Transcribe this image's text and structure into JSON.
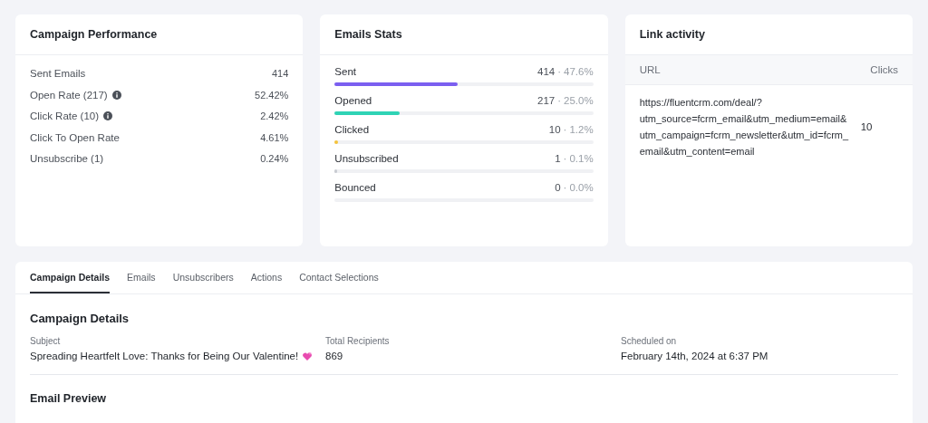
{
  "performance": {
    "title": "Campaign Performance",
    "rows": [
      {
        "label": "Sent Emails",
        "value": "414",
        "info": false
      },
      {
        "label": "Open Rate (217)",
        "value": "52.42%",
        "info": true
      },
      {
        "label": "Click Rate (10)",
        "value": "2.42%",
        "info": true
      },
      {
        "label": "Click To Open Rate",
        "value": "4.61%",
        "info": false
      },
      {
        "label": "Unsubscribe (1)",
        "value": "0.24%",
        "info": false
      }
    ]
  },
  "email_stats": {
    "title": "Emails Stats",
    "rows": [
      {
        "label": "Sent",
        "count": "414",
        "separator": "·",
        "percent": "47.6%",
        "level": 0.476,
        "color": "#7b5ff0"
      },
      {
        "label": "Opened",
        "count": "217",
        "separator": "·",
        "percent": "25.0%",
        "level": 0.25,
        "color": "#2fd3b5"
      },
      {
        "label": "Clicked",
        "count": "10",
        "separator": "·",
        "percent": "1.2%",
        "level": 0.012,
        "color": "#f5c33b"
      },
      {
        "label": "Unsubscribed",
        "count": "1",
        "separator": "·",
        "percent": "0.1%",
        "level": 0.001
      },
      {
        "label": "Bounced",
        "count": "0",
        "separator": "·",
        "percent": "0.0%",
        "level": 0
      }
    ]
  },
  "link_activity": {
    "title": "Link activity",
    "columns": [
      "URL",
      "Clicks"
    ],
    "rows": [
      {
        "url": "https://fluentcrm.com/deal/?utm_source=fcrm_email&utm_medium=email&utm_campaign=fcrm_newsletter&utm_id=fcrm_email&utm_content=email",
        "clicks": "10"
      }
    ]
  },
  "tabs": [
    {
      "label": "Campaign Details",
      "selected": true
    },
    {
      "label": "Emails",
      "selected": false
    },
    {
      "label": "Unsubscribers",
      "selected": false
    },
    {
      "label": "Actions",
      "selected": false
    },
    {
      "label": "Contact Selections",
      "selected": false
    }
  ],
  "details": {
    "title": "Campaign Details",
    "fields": [
      {
        "label": "Subject",
        "value": "Spreading Heartfelt Love: Thanks for Being Our Valentine!",
        "heart": true
      },
      {
        "label": "Total Recipients",
        "value": "869",
        "heart": false
      },
      {
        "label": "Scheduled on",
        "value": "February 14th, 2024 at 6:37 PM",
        "heart": false
      }
    ]
  },
  "preview": {
    "title": "Email Preview"
  }
}
